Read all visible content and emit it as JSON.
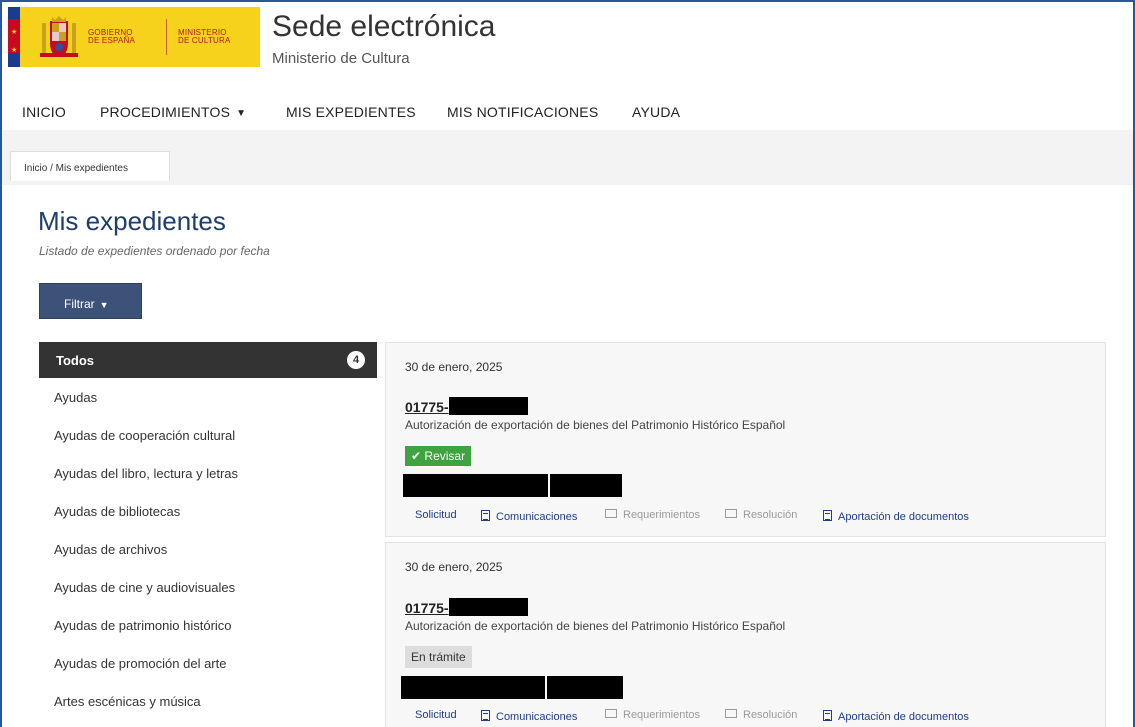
{
  "header": {
    "gov_line1": "GOBIERNO",
    "gov_line2": "DE ESPAÑA",
    "min_line1": "MINISTERIO",
    "min_line2": "DE CULTURA",
    "title": "Sede electrónica",
    "subtitle": "Ministerio de Cultura"
  },
  "nav": {
    "items": [
      "INICIO",
      "PROCEDIMIENTOS",
      "MIS EXPEDIENTES",
      "MIS NOTIFICACIONES",
      "AYUDA"
    ],
    "dropdown_icon": "caret-down-icon"
  },
  "breadcrumb": "Inicio / Mis expedientes",
  "main": {
    "title": "Mis expedientes",
    "subtitle": "Listado de expedientes ordenado por fecha",
    "filter_label": "Filtrar"
  },
  "sidebar": {
    "active": {
      "label": "Todos",
      "count": "4"
    },
    "items": [
      "Ayudas",
      "Ayudas de cooperación cultural",
      "Ayudas del libro, lectura y letras",
      "Ayudas de bibliotecas",
      "Ayudas de archivos",
      "Ayudas de cine y audiovisuales",
      "Ayudas de patrimonio histórico",
      "Ayudas de promoción del arte",
      "Artes escénicas y música"
    ]
  },
  "cards": [
    {
      "date": "30 de enero, 2025",
      "code": "01775-",
      "description": "Autorización de exportación de bienes del Patrimonio Histórico Español",
      "status": "Revisar",
      "status_icon": "check-icon",
      "status_color": "#3fa43f",
      "links": [
        "Solicitud",
        "Comunicaciones",
        "Requerimientos",
        "Resolución",
        "Aportación de documentos"
      ]
    },
    {
      "date": "30 de enero, 2025",
      "code": "01775-",
      "description": "Autorización de exportación de bienes del Patrimonio Histórico Español",
      "status": "En trámite",
      "status_color": "#dddddd",
      "links": [
        "Solicitud",
        "Comunicaciones",
        "Requerimientos",
        "Resolución",
        "Aportación de documentos"
      ]
    }
  ],
  "colors": {
    "brand_blue": "#1f3d6b",
    "filter_button": "#3d5279",
    "sidebar_active": "#333333",
    "link_active": "#1f3d8b",
    "link_disabled": "#9a9a9a"
  }
}
